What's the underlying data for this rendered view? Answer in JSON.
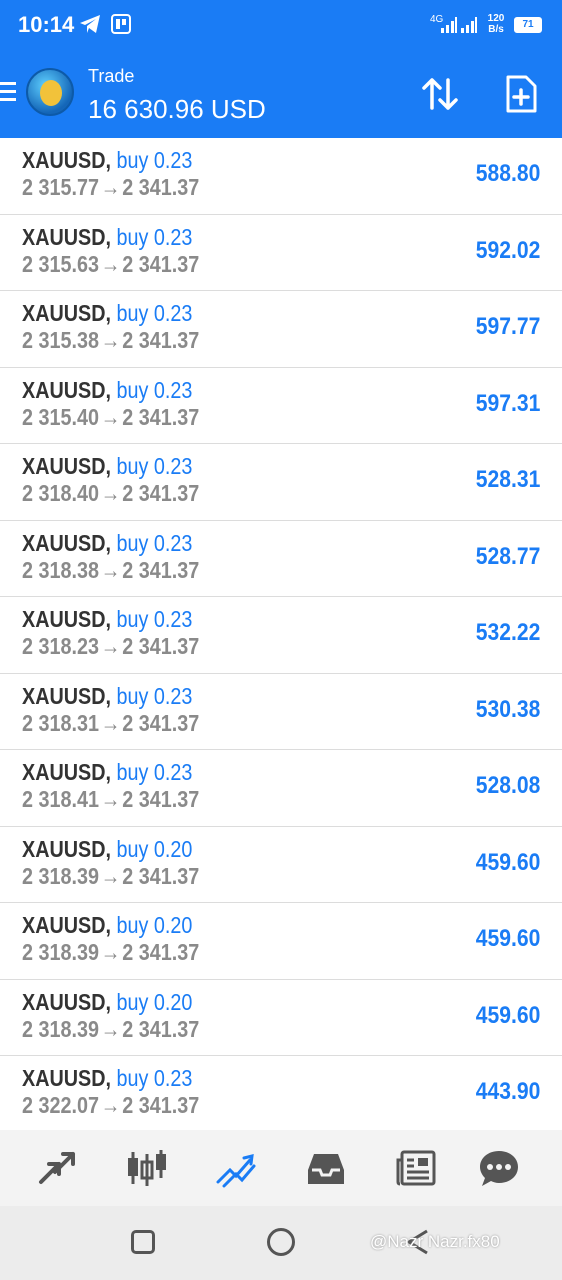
{
  "status_bar": {
    "time": "10:14",
    "network": "4G",
    "speed_top": "120",
    "speed_bottom": "B/s",
    "battery": "71"
  },
  "header": {
    "title": "Trade",
    "balance": "16 630.96 USD",
    "icons": [
      "menu-icon",
      "metatrader-logo",
      "sort-icon",
      "new-order-icon"
    ]
  },
  "colors": {
    "accent": "#1a7cf5",
    "symbol": "#333333",
    "price": "#8a8a8a",
    "profit": "#1a7cf5"
  },
  "positions": [
    {
      "symbol": "XAUUSD,",
      "side": "buy 0.23",
      "open": "2 315.77",
      "arrow": "→",
      "current": "2 341.37",
      "profit": "588.80"
    },
    {
      "symbol": "XAUUSD,",
      "side": "buy 0.23",
      "open": "2 315.63",
      "arrow": "→",
      "current": "2 341.37",
      "profit": "592.02"
    },
    {
      "symbol": "XAUUSD,",
      "side": "buy 0.23",
      "open": "2 315.38",
      "arrow": "→",
      "current": "2 341.37",
      "profit": "597.77"
    },
    {
      "symbol": "XAUUSD,",
      "side": "buy 0.23",
      "open": "2 315.40",
      "arrow": "→",
      "current": "2 341.37",
      "profit": "597.31"
    },
    {
      "symbol": "XAUUSD,",
      "side": "buy 0.23",
      "open": "2 318.40",
      "arrow": "→",
      "current": "2 341.37",
      "profit": "528.31"
    },
    {
      "symbol": "XAUUSD,",
      "side": "buy 0.23",
      "open": "2 318.38",
      "arrow": "→",
      "current": "2 341.37",
      "profit": "528.77"
    },
    {
      "symbol": "XAUUSD,",
      "side": "buy 0.23",
      "open": "2 318.23",
      "arrow": "→",
      "current": "2 341.37",
      "profit": "532.22"
    },
    {
      "symbol": "XAUUSD,",
      "side": "buy 0.23",
      "open": "2 318.31",
      "arrow": "→",
      "current": "2 341.37",
      "profit": "530.38"
    },
    {
      "symbol": "XAUUSD,",
      "side": "buy 0.23",
      "open": "2 318.41",
      "arrow": "→",
      "current": "2 341.37",
      "profit": "528.08"
    },
    {
      "symbol": "XAUUSD,",
      "side": "buy 0.20",
      "open": "2 318.39",
      "arrow": "→",
      "current": "2 341.37",
      "profit": "459.60"
    },
    {
      "symbol": "XAUUSD,",
      "side": "buy 0.20",
      "open": "2 318.39",
      "arrow": "→",
      "current": "2 341.37",
      "profit": "459.60"
    },
    {
      "symbol": "XAUUSD,",
      "side": "buy 0.20",
      "open": "2 318.39",
      "arrow": "→",
      "current": "2 341.37",
      "profit": "459.60"
    },
    {
      "symbol": "XAUUSD,",
      "side": "buy 0.23",
      "open": "2 322.07",
      "arrow": "→",
      "current": "2 341.37",
      "profit": "443.90"
    }
  ],
  "bottom_nav": [
    {
      "name": "quotes",
      "icon": "quotes-arrows-icon",
      "active": false
    },
    {
      "name": "chart",
      "icon": "candlestick-icon",
      "active": false
    },
    {
      "name": "trade",
      "icon": "trade-trend-icon",
      "active": true
    },
    {
      "name": "history",
      "icon": "inbox-tray-icon",
      "active": false
    },
    {
      "name": "news",
      "icon": "newspaper-icon",
      "active": false
    },
    {
      "name": "messages",
      "icon": "chat-bubble-icon",
      "active": false
    }
  ],
  "watermark": "@Nazr Nazr.fx80"
}
